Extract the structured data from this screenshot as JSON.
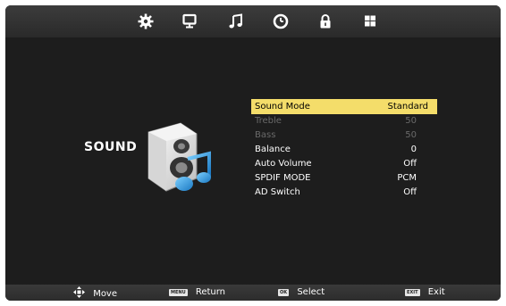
{
  "tabs": [
    {
      "icon": "gear-icon"
    },
    {
      "icon": "monitor-icon"
    },
    {
      "icon": "music-note-icon"
    },
    {
      "icon": "clock-icon"
    },
    {
      "icon": "lock-icon"
    },
    {
      "icon": "grid-icon"
    }
  ],
  "section": {
    "title": "SOUND",
    "icon": "speaker-icon"
  },
  "menu": {
    "items": [
      {
        "label": "Sound Mode",
        "value": "Standard",
        "state": "selected"
      },
      {
        "label": "Treble",
        "value": "50",
        "state": "disabled"
      },
      {
        "label": "Bass",
        "value": "50",
        "state": "disabled"
      },
      {
        "label": "Balance",
        "value": "0",
        "state": "normal"
      },
      {
        "label": "Auto Volume",
        "value": "Off",
        "state": "normal"
      },
      {
        "label": "SPDIF MODE",
        "value": "PCM",
        "state": "normal"
      },
      {
        "label": "AD Switch",
        "value": "Off",
        "state": "normal"
      }
    ]
  },
  "hints": {
    "move": {
      "label": "Move",
      "icon": "dpad-icon"
    },
    "return": {
      "label": "Return",
      "key": "MENU"
    },
    "select": {
      "label": "Select",
      "key": "OK"
    },
    "exit": {
      "label": "Exit",
      "key": "EXIT"
    }
  },
  "colors": {
    "highlight": "#f4dd6a",
    "background": "#1d1d1d",
    "disabled_text": "#6a6a6a",
    "accent_blue": "#2a9ad8"
  }
}
